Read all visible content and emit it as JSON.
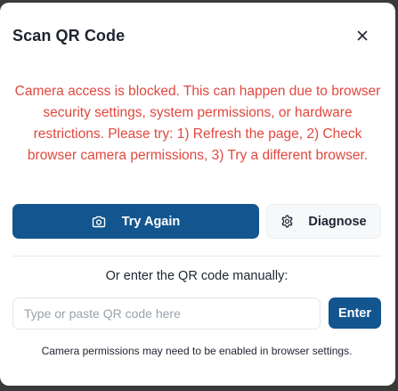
{
  "dialog": {
    "title": "Scan QR Code",
    "close_icon": "close-icon"
  },
  "error": {
    "message": "Camera access is blocked. This can happen due to browser security settings, system permissions, or hardware restrictions. Please try: 1) Refresh the page, 2) Check browser camera permissions, 3) Try a different browser."
  },
  "actions": {
    "try_again_label": "Try Again",
    "try_again_icon": "camera-icon",
    "diagnose_label": "Diagnose",
    "diagnose_icon": "gear-icon"
  },
  "manual": {
    "label": "Or enter the QR code manually:",
    "placeholder": "Type or paste QR code here",
    "value": "",
    "enter_label": "Enter"
  },
  "hint": "Camera permissions may need to be enabled in browser settings.",
  "colors": {
    "primary": "#12558f",
    "error": "#e0483f",
    "text": "#1f2430"
  }
}
